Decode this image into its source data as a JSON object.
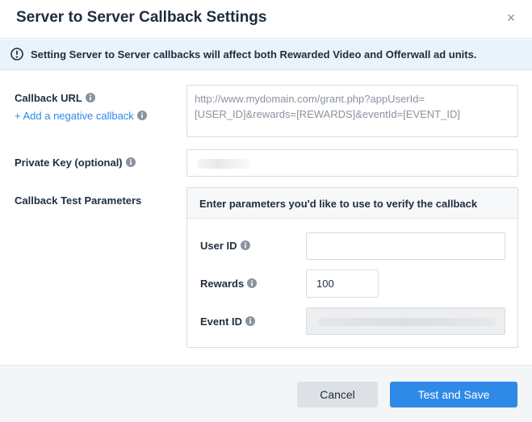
{
  "dialog": {
    "title": "Server to Server Callback Settings",
    "close_glyph": "×"
  },
  "banner": {
    "icon": "info-circle-icon",
    "text": "Setting Server to Server callbacks will affect both Rewarded Video and Offerwall ad units."
  },
  "form": {
    "callback_url_label": "Callback URL",
    "add_negative_link": "+ Add a negative callback",
    "callback_url_placeholder": "http://www.mydomain.com/grant.php?appUserId=[USER_ID]&rewards=[REWARDS]&eventId=[EVENT_ID]",
    "private_key_label": "Private Key (optional)",
    "test_params_label": "Callback Test Parameters"
  },
  "params": {
    "header": "Enter parameters you'd like to use to verify the callback",
    "user_id_label": "User ID",
    "user_id_value": "",
    "rewards_label": "Rewards",
    "rewards_value": "100",
    "event_id_label": "Event ID"
  },
  "footer": {
    "cancel_label": "Cancel",
    "save_label": "Test and Save"
  },
  "colors": {
    "accent": "#2e8ae6",
    "banner_bg": "#e8f3fc",
    "text": "#1f2d3d",
    "info_icon": "#8a939e"
  }
}
